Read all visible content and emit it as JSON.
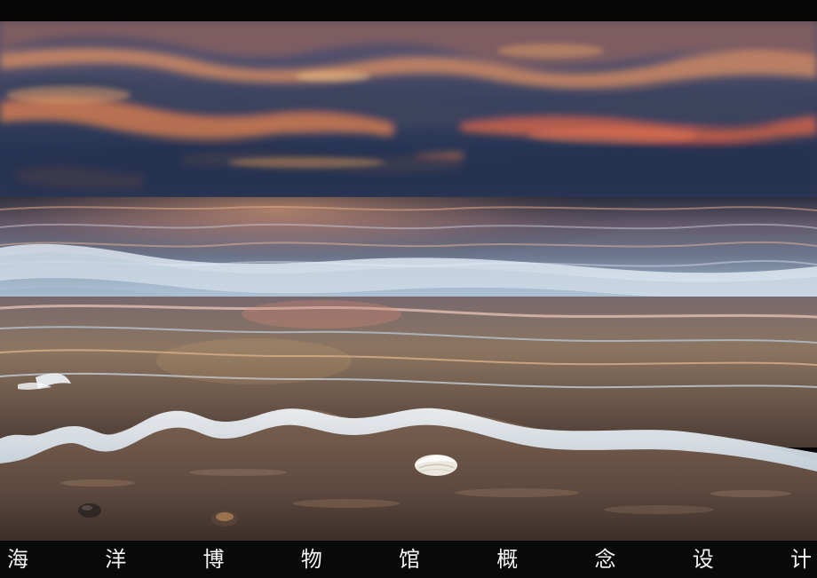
{
  "scene": {
    "subject": "sunset-beach-seascape",
    "colors": {
      "sky_dark": "#2c3552",
      "sky_mid": "#49506f",
      "sunset_orange": "#f3a35f",
      "sunset_red": "#e95f42",
      "sea_blue": "#2b3f56",
      "foam": "#dce8f0",
      "sand": "#6d5445"
    }
  },
  "caption": {
    "chars": [
      "海",
      "洋",
      "博",
      "物",
      "馆",
      "概",
      "念",
      "设",
      "计"
    ]
  }
}
